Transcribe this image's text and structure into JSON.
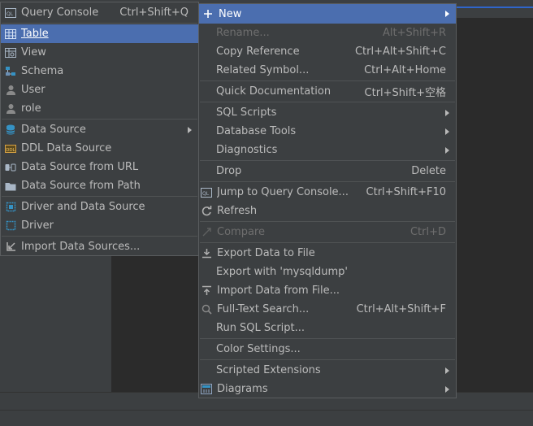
{
  "context_menu": {
    "new": "New",
    "rename": {
      "label": "Rename...",
      "shortcut": "Alt+Shift+R"
    },
    "copy_reference": {
      "label": "Copy Reference",
      "shortcut": "Ctrl+Alt+Shift+C"
    },
    "related_symbol": {
      "label": "Related Symbol...",
      "shortcut": "Ctrl+Alt+Home"
    },
    "quick_documentation": {
      "label": "Quick Documentation",
      "shortcut": "Ctrl+Shift+空格"
    },
    "sql_scripts": "SQL Scripts",
    "database_tools": "Database Tools",
    "diagnostics": "Diagnostics",
    "drop": {
      "label": "Drop",
      "shortcut": "Delete"
    },
    "jump_to_console": {
      "label": "Jump to Query Console...",
      "shortcut": "Ctrl+Shift+F10"
    },
    "refresh": "Refresh",
    "compare": {
      "label": "Compare",
      "shortcut": "Ctrl+D"
    },
    "export_data": "Export Data to File",
    "export_mysqldump": "Export with 'mysqldump'",
    "import_data": "Import Data from File...",
    "full_text_search": {
      "label": "Full-Text Search...",
      "shortcut": "Ctrl+Alt+Shift+F"
    },
    "run_sql_script": "Run SQL Script...",
    "color_settings": "Color Settings...",
    "scripted_extensions": "Scripted Extensions",
    "diagrams": "Diagrams"
  },
  "new_submenu": {
    "query_console": {
      "label": "Query Console",
      "shortcut": "Ctrl+Shift+Q"
    },
    "table": "Table",
    "view": "View",
    "schema": "Schema",
    "user": "User",
    "role": "role",
    "data_source": "Data Source",
    "ddl_data_source": "DDL Data Source",
    "data_source_from_url": "Data Source from URL",
    "data_source_from_path": "Data Source from Path",
    "driver_and_data_source": "Driver and Data Source",
    "driver": "Driver",
    "import_data_sources": "Import Data Sources..."
  },
  "colors": {
    "menu_bg": "#3c3f41",
    "selection": "#4b6eaf",
    "text": "#bbbbbb",
    "disabled": "#6e6e6e",
    "accent_blue": "#3592c4"
  }
}
